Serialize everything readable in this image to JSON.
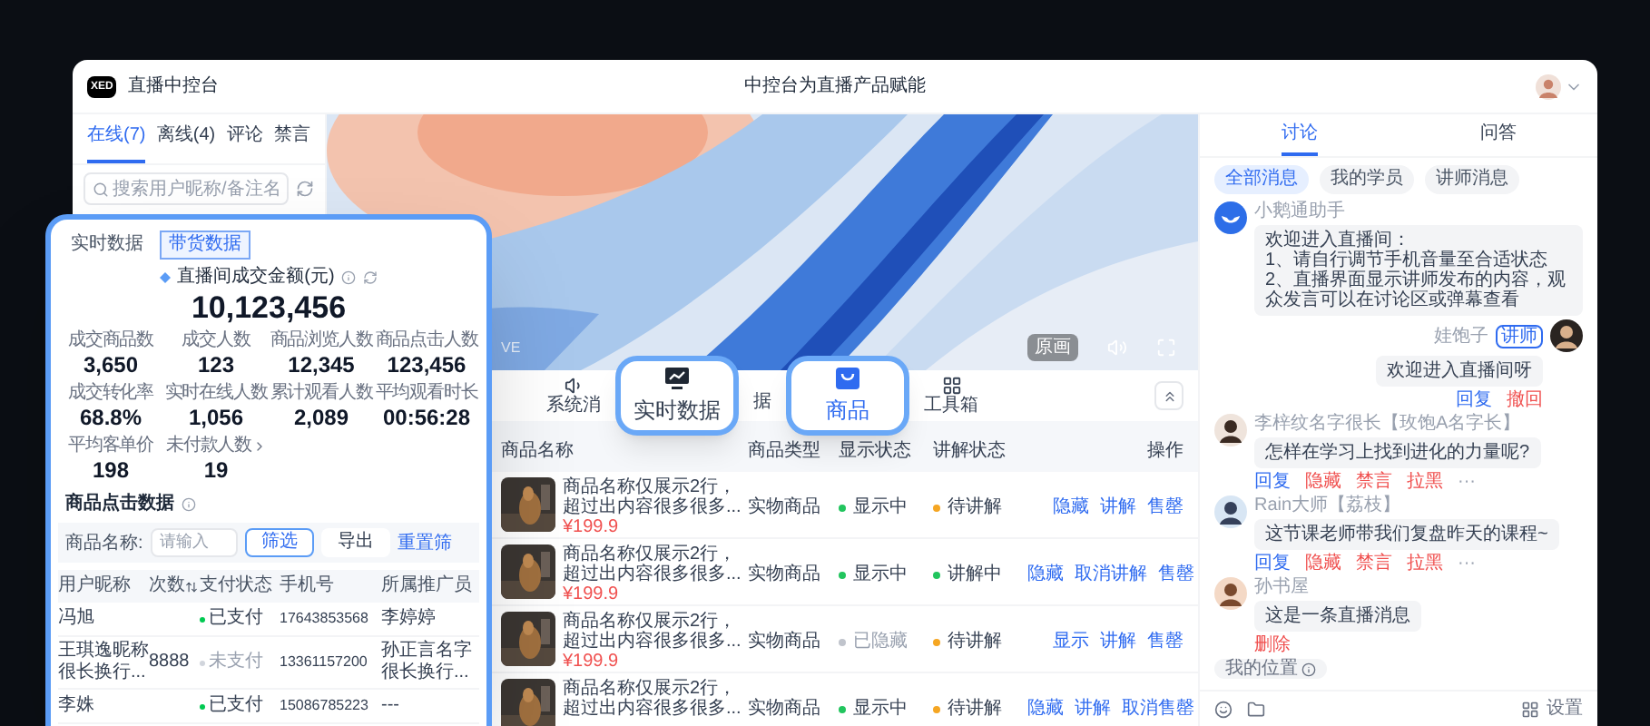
{
  "window": {
    "logo": "XED",
    "title": "直播中控台",
    "subtitle": "中控台为直播产品赋能"
  },
  "left_panel": {
    "tabs": [
      {
        "label": "在线(7)",
        "selected": true
      },
      {
        "label": "离线(4)",
        "selected": false
      },
      {
        "label": "评论",
        "selected": false
      },
      {
        "label": "禁言",
        "selected": false
      }
    ],
    "search": {
      "placeholder": "搜索用户昵称/备注名"
    }
  },
  "video": {
    "live_label": "VE",
    "quality": "原画"
  },
  "toolbar": {
    "items": [
      {
        "kind": "sound",
        "label": "系统消",
        "selected": false
      },
      {
        "kind": "data-callout",
        "label": "实时数据",
        "selected": false
      },
      {
        "kind": "fragment",
        "label": "据",
        "selected": false
      },
      {
        "kind": "goods-callout",
        "label": "商品",
        "selected": true
      },
      {
        "kind": "toolbox",
        "label": "工具箱",
        "selected": false
      }
    ]
  },
  "product_table": {
    "columns": [
      "商品名称",
      "商品类型",
      "显示状态",
      "讲解状态",
      "操作"
    ],
    "rows": [
      {
        "name": [
          "商品名称仅展示2行，",
          "超过出内容很多很多..."
        ],
        "price": "¥199.9",
        "type": "实物商品",
        "display": {
          "text": "显示中",
          "color": "#22c55e",
          "muted": false
        },
        "explain": {
          "text": "待讲解",
          "color": "#f5a623"
        },
        "actions": [
          "隐藏",
          "讲解",
          "售罄"
        ]
      },
      {
        "name": [
          "商品名称仅展示2行，",
          "超过出内容很多很多..."
        ],
        "price": "¥199.9",
        "type": "实物商品",
        "display": {
          "text": "显示中",
          "color": "#22c55e",
          "muted": false
        },
        "explain": {
          "text": "讲解中",
          "color": "#22c55e"
        },
        "actions": [
          "隐藏",
          "取消讲解",
          "售罄"
        ]
      },
      {
        "name": [
          "商品名称仅展示2行，",
          "超过出内容很多很多..."
        ],
        "price": "¥199.9",
        "type": "实物商品",
        "display": {
          "text": "已隐藏",
          "color": "#c0c4cc",
          "muted": true
        },
        "explain": {
          "text": "待讲解",
          "color": "#f5a623"
        },
        "actions": [
          "显示",
          "讲解",
          "售罄"
        ]
      },
      {
        "name": [
          "商品名称仅展示2行，",
          "超过出内容很多很多..."
        ],
        "type": "实物商品",
        "display": {
          "text": "显示中",
          "color": "#22c55e",
          "muted": false
        },
        "explain": {
          "text": "待讲解",
          "color": "#f5a623"
        },
        "actions": [
          "隐藏",
          "讲解",
          "取消售罄"
        ]
      }
    ]
  },
  "stats_card": {
    "tabs": [
      {
        "label": "实时数据",
        "selected": false
      },
      {
        "label": "带货数据",
        "selected": true
      }
    ],
    "headline": {
      "label": "直播间成交金额(元)",
      "value": "10,123,456"
    },
    "metrics": [
      {
        "kind": "plain",
        "label": "成交商品数",
        "value": "3,650"
      },
      {
        "kind": "plain",
        "label": "成交人数",
        "value": "123"
      },
      {
        "kind": "plain",
        "label": "商品浏览人数",
        "value": "12,345"
      },
      {
        "kind": "plain",
        "label": "商品点击人数",
        "value": "123,456"
      },
      {
        "kind": "plain",
        "label": "成交转化率",
        "value": "68.8%"
      },
      {
        "kind": "plain",
        "label": "实时在线人数",
        "value": "1,056"
      },
      {
        "kind": "plain",
        "label": "累计观看人数",
        "value": "2,089"
      },
      {
        "kind": "plain",
        "label": "平均观看时长",
        "value": "00:56:28"
      },
      {
        "kind": "plain",
        "label": "平均客单价",
        "value": "198"
      },
      {
        "kind": "link",
        "label": "未付款人数",
        "value": "19"
      }
    ],
    "section_title": "商品点击数据",
    "filter": {
      "label": "商品名称:",
      "placeholder": "请输入",
      "buttons": [
        {
          "kind": "primary",
          "label": "筛选"
        },
        {
          "kind": "plain",
          "label": "导出"
        }
      ],
      "reset": "重置筛"
    },
    "table": {
      "columns": [
        "用户昵称",
        "次数",
        "支付状态",
        "手机号",
        "所属推广员"
      ],
      "rows": [
        {
          "name": "冯旭",
          "paid": {
            "text": "已支付",
            "done": true
          },
          "phone": "17643853568",
          "promoter": "李婷婷"
        },
        {
          "name": "王琪逸昵称很长换行...",
          "count": "8888",
          "paid": {
            "text": "未支付",
            "done": false
          },
          "phone": "13361157200",
          "promoter": "孙正言名字很长换行..."
        },
        {
          "name": "李姝",
          "paid": {
            "text": "已支付",
            "done": true
          },
          "phone": "15086785223",
          "promoter": "---"
        }
      ]
    }
  },
  "chat": {
    "tabs": [
      {
        "label": "讨论",
        "selected": true
      },
      {
        "label": "问答",
        "selected": false
      }
    ],
    "filters": [
      {
        "label": "全部消息",
        "selected": true
      },
      {
        "label": "我的学员",
        "selected": false
      },
      {
        "label": "讲师消息",
        "selected": false
      }
    ],
    "messages": [
      {
        "kind": "bot",
        "name": "小鹅通助手",
        "lines": [
          "欢迎进入直播间：",
          "1、请自行调节手机音量至合适状态",
          "2、直播界面显示讲师发布的内容，观众发言可以在讨论区或弹幕查看"
        ]
      },
      {
        "kind": "self",
        "name": "娃饱子",
        "badge": "讲师",
        "lines": [
          "欢迎进入直播间呀"
        ],
        "actions": [
          {
            "kind": "link",
            "label": "回复"
          },
          {
            "kind": "danger",
            "label": "撤回"
          }
        ]
      },
      {
        "kind": "user",
        "name": "李梓纹名字很长【玫饱A名字长】",
        "lines": [
          "怎样在学习上找到进化的力量呢?"
        ],
        "actions": [
          {
            "kind": "link",
            "label": "回复"
          },
          {
            "kind": "danger",
            "label": "隐藏"
          },
          {
            "kind": "danger",
            "label": "禁言"
          },
          {
            "kind": "danger",
            "label": "拉黑"
          },
          {
            "kind": "more",
            "label": "···"
          }
        ]
      },
      {
        "kind": "user",
        "name": "Rain大师【荔枝】",
        "lines": [
          "这节课老师带我们复盘昨天的课程~"
        ],
        "actions": [
          {
            "kind": "link",
            "label": "回复"
          },
          {
            "kind": "danger",
            "label": "隐藏"
          },
          {
            "kind": "danger",
            "label": "禁言"
          },
          {
            "kind": "danger",
            "label": "拉黑"
          },
          {
            "kind": "more",
            "label": "···"
          }
        ]
      },
      {
        "kind": "user",
        "name": "孙书屋",
        "lines": [
          "这是一条直播消息"
        ],
        "actions": [
          {
            "kind": "danger",
            "label": "删除"
          }
        ]
      }
    ],
    "location": "我的位置",
    "settings": "设置"
  }
}
